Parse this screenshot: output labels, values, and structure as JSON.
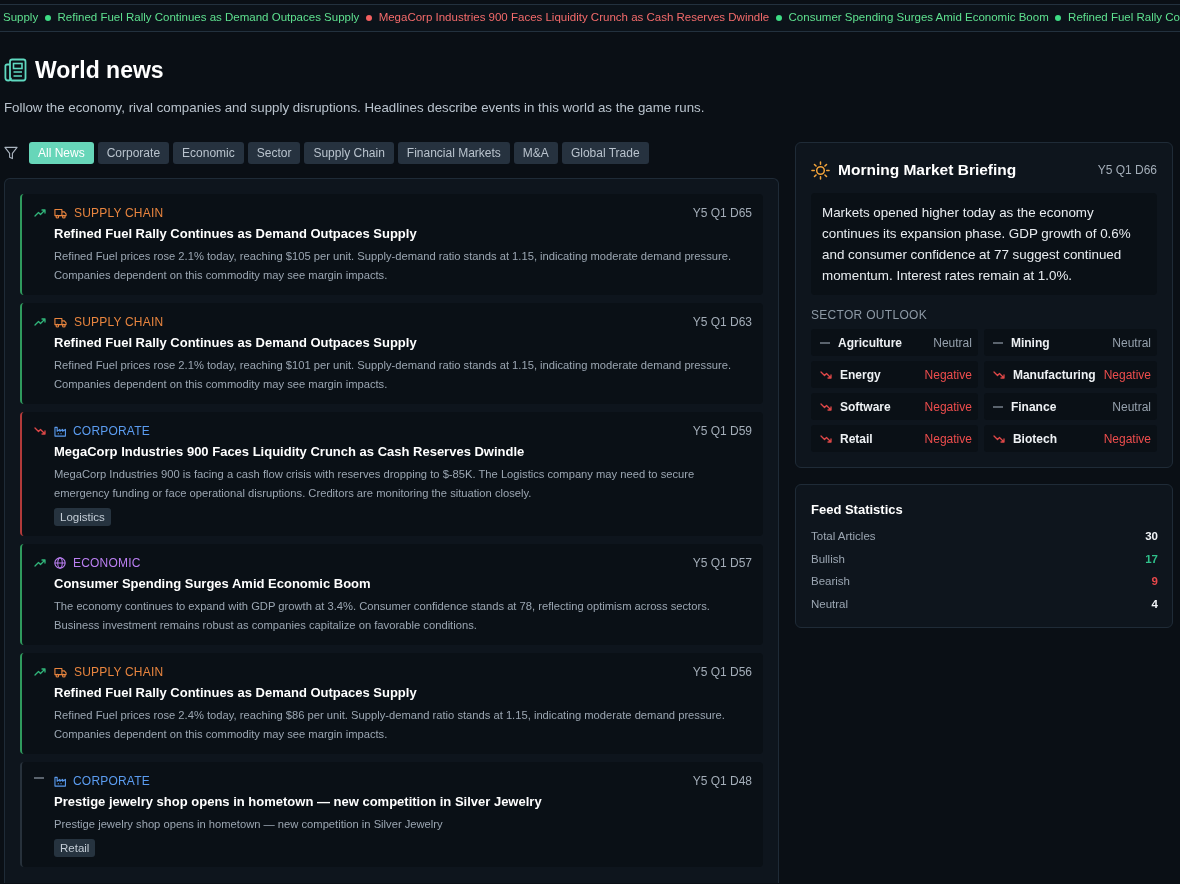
{
  "ticker": [
    {
      "text": "Supply",
      "kind": "bullish",
      "start_hidden": true
    },
    {
      "text": "Refined Fuel Rally Continues as Demand Outpaces Supply",
      "kind": "bullish",
      "start_hidden": false
    },
    {
      "text": "MegaCorp Industries 900 Faces Liquidity Crunch as Cash Reserves Dwindle",
      "kind": "bearish",
      "start_hidden": false
    },
    {
      "text": "Consumer Spending Surges Amid Economic Boom",
      "kind": "bullish",
      "start_hidden": false
    },
    {
      "text": "Refined Fuel Rally Co",
      "kind": "bullish",
      "start_hidden": false
    }
  ],
  "header": {
    "title": "World news",
    "subtitle": "Follow the economy, rival companies and supply disruptions. Headlines describe events in this world as the game runs."
  },
  "filters": [
    {
      "label": "All News",
      "selected": true
    },
    {
      "label": "Corporate",
      "selected": false
    },
    {
      "label": "Economic",
      "selected": false
    },
    {
      "label": "Sector",
      "selected": false
    },
    {
      "label": "Supply Chain",
      "selected": false
    },
    {
      "label": "Financial Markets",
      "selected": false
    },
    {
      "label": "M&A",
      "selected": false
    },
    {
      "label": "Global Trade",
      "selected": false
    }
  ],
  "articles": [
    {
      "kind": "bullish",
      "category": {
        "kind": "supply_chain",
        "label": "SUPPLY CHAIN"
      },
      "date": "Y5 Q1 D65",
      "title": "Refined Fuel Rally Continues as Demand Outpaces Supply",
      "summary": "Refined Fuel prices rose 2.1% today, reaching $105 per unit. Supply-demand ratio stands at 1.15, indicating moderate demand pressure. Companies dependent on this commodity may see margin impacts."
    },
    {
      "kind": "bullish",
      "category": {
        "kind": "supply_chain",
        "label": "SUPPLY CHAIN"
      },
      "date": "Y5 Q1 D63",
      "title": "Refined Fuel Rally Continues as Demand Outpaces Supply",
      "summary": "Refined Fuel prices rose 2.1% today, reaching $101 per unit. Supply-demand ratio stands at 1.15, indicating moderate demand pressure. Companies dependent on this commodity may see margin impacts."
    },
    {
      "kind": "bearish",
      "category": {
        "kind": "corporate",
        "label": "CORPORATE"
      },
      "date": "Y5 Q1 D59",
      "title": "MegaCorp Industries 900 Faces Liquidity Crunch as Cash Reserves Dwindle",
      "summary": "MegaCorp Industries 900 is facing a cash flow crisis with reserves dropping to $-85K. The Logistics company may need to secure emergency funding or face operational disruptions. Creditors are monitoring the situation closely.",
      "tags": [
        "Logistics"
      ]
    },
    {
      "kind": "bullish",
      "category": {
        "kind": "economic",
        "label": "ECONOMIC"
      },
      "date": "Y5 Q1 D57",
      "title": "Consumer Spending Surges Amid Economic Boom",
      "summary": "The economy continues to expand with GDP growth at 3.4%. Consumer confidence stands at 78, reflecting optimism across sectors. Business investment remains robust as companies capitalize on favorable conditions."
    },
    {
      "kind": "bullish",
      "category": {
        "kind": "supply_chain",
        "label": "SUPPLY CHAIN"
      },
      "date": "Y5 Q1 D56",
      "title": "Refined Fuel Rally Continues as Demand Outpaces Supply",
      "summary": "Refined Fuel prices rose 2.4% today, reaching $86 per unit. Supply-demand ratio stands at 1.15, indicating moderate demand pressure. Companies dependent on this commodity may see margin impacts."
    },
    {
      "kind": "neutral",
      "category": {
        "kind": "corporate",
        "label": "CORPORATE"
      },
      "date": "Y5 Q1 D48",
      "title": "Prestige jewelry shop opens in hometown — new competition in Silver Jewelry",
      "summary": "Prestige jewelry shop opens in hometown — new competition in Silver Jewelry",
      "tags": [
        "Retail"
      ]
    }
  ],
  "briefing": {
    "title": "Morning Market Briefing",
    "date": "Y5 Q1 D66",
    "text": "Markets opened higher today as the economy continues its expansion phase. GDP growth of 0.6% and consumer confidence at 77 suggest continued momentum. Interest rates remain at 1.0%.",
    "sector_heading": "SECTOR OUTLOOK",
    "sectors": [
      {
        "name": "Agriculture",
        "kind": "neutral",
        "label": "Neutral"
      },
      {
        "name": "Mining",
        "kind": "neutral",
        "label": "Neutral"
      },
      {
        "name": "Energy",
        "kind": "negative",
        "label": "Negative"
      },
      {
        "name": "Manufacturing",
        "kind": "negative",
        "label": "Negative"
      },
      {
        "name": "Software",
        "kind": "negative",
        "label": "Negative"
      },
      {
        "name": "Finance",
        "kind": "neutral",
        "label": "Neutral"
      },
      {
        "name": "Retail",
        "kind": "negative",
        "label": "Negative"
      },
      {
        "name": "Biotech",
        "kind": "negative",
        "label": "Negative"
      }
    ]
  },
  "feed_statistics": {
    "title": "Feed Statistics",
    "rows": [
      {
        "kind": "total",
        "label": "Total Articles",
        "value": "30"
      },
      {
        "kind": "bullish",
        "label": "Bullish",
        "value": "17"
      },
      {
        "kind": "bearish",
        "label": "Bearish",
        "value": "9"
      },
      {
        "kind": "neutral",
        "label": "Neutral",
        "value": "4"
      }
    ]
  }
}
